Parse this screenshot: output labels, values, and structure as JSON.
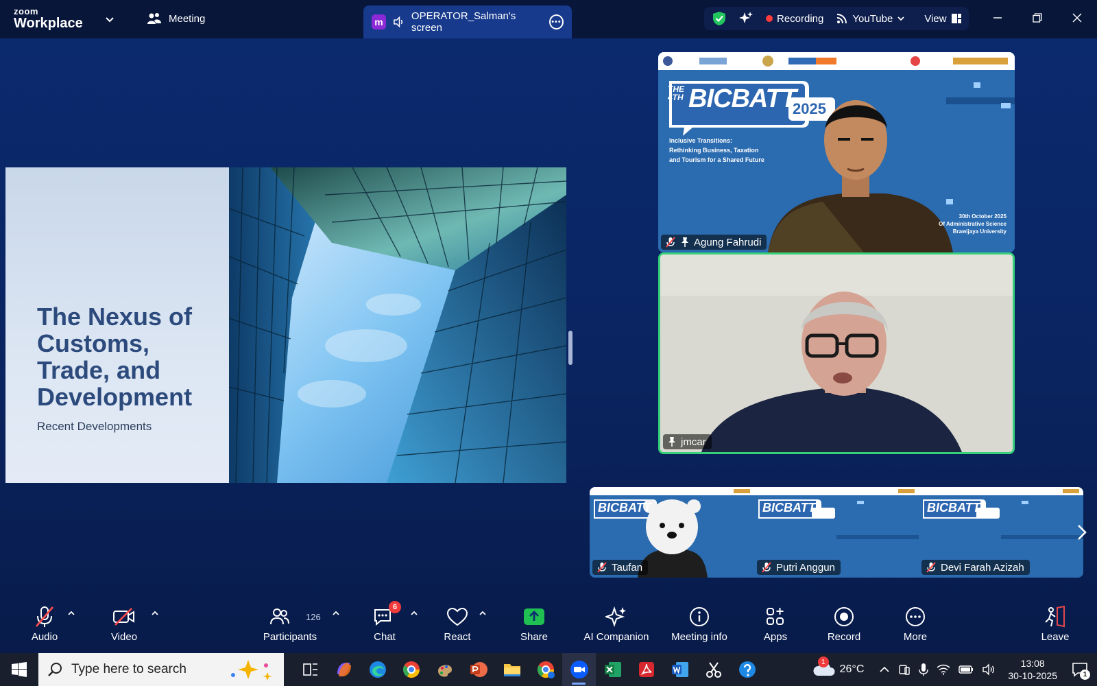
{
  "app": {
    "brand_top": "zoom",
    "brand_bottom": "Workplace"
  },
  "topbar": {
    "meeting_label": "Meeting",
    "share_badge_letter": "m",
    "share_tab_label": "OPERATOR_Salman's screen",
    "recording_label": "Recording",
    "stream_label": "YouTube",
    "view_label": "View"
  },
  "slide": {
    "title_lines": [
      "The Nexus of",
      "Customs,",
      "Trade, and",
      "Development"
    ],
    "subtitle": "Recent Developments"
  },
  "participants_main": [
    {
      "name": "Agung Fahrudi",
      "muted": true,
      "pinned": true
    },
    {
      "name": "jmcar",
      "muted": false,
      "pinned": true,
      "active_speaker": true
    }
  ],
  "conference_banner": {
    "event_line1": "THE",
    "event_line2": "4TH",
    "event_name": "BICBATT",
    "event_year": "2025",
    "theme_lines": [
      "Inclusive Transitions:",
      "Rethinking Business, Taxation",
      "and Tourism for a Shared Future"
    ],
    "date_lines": [
      "30th October 2025",
      "Of Administrative Science",
      "Brawijaya University"
    ]
  },
  "strip": [
    {
      "name": "Taufan",
      "muted": true,
      "avatar": "polar-bear"
    },
    {
      "name": "Putri Anggun",
      "muted": true
    },
    {
      "name": "Devi Farah Azizah",
      "muted": true
    }
  ],
  "toolbar": {
    "audio": "Audio",
    "video": "Video",
    "participants": "Participants",
    "participants_count": "126",
    "chat": "Chat",
    "chat_badge": "6",
    "react": "React",
    "share": "Share",
    "ai": "AI Companion",
    "info": "Meeting info",
    "apps": "Apps",
    "record": "Record",
    "more": "More",
    "leave": "Leave"
  },
  "taskbar": {
    "search_placeholder": "Type here to search",
    "weather_temp": "26°C",
    "weather_badge": "1",
    "time": "13:08",
    "date": "30-10-2025",
    "notif_count": "1"
  },
  "colors": {
    "bg": "#0b2a6f",
    "active_speaker": "#36d07a",
    "record": "#ff3b3b",
    "share_green": "#1fbf52",
    "leave_red": "#e5484d"
  }
}
